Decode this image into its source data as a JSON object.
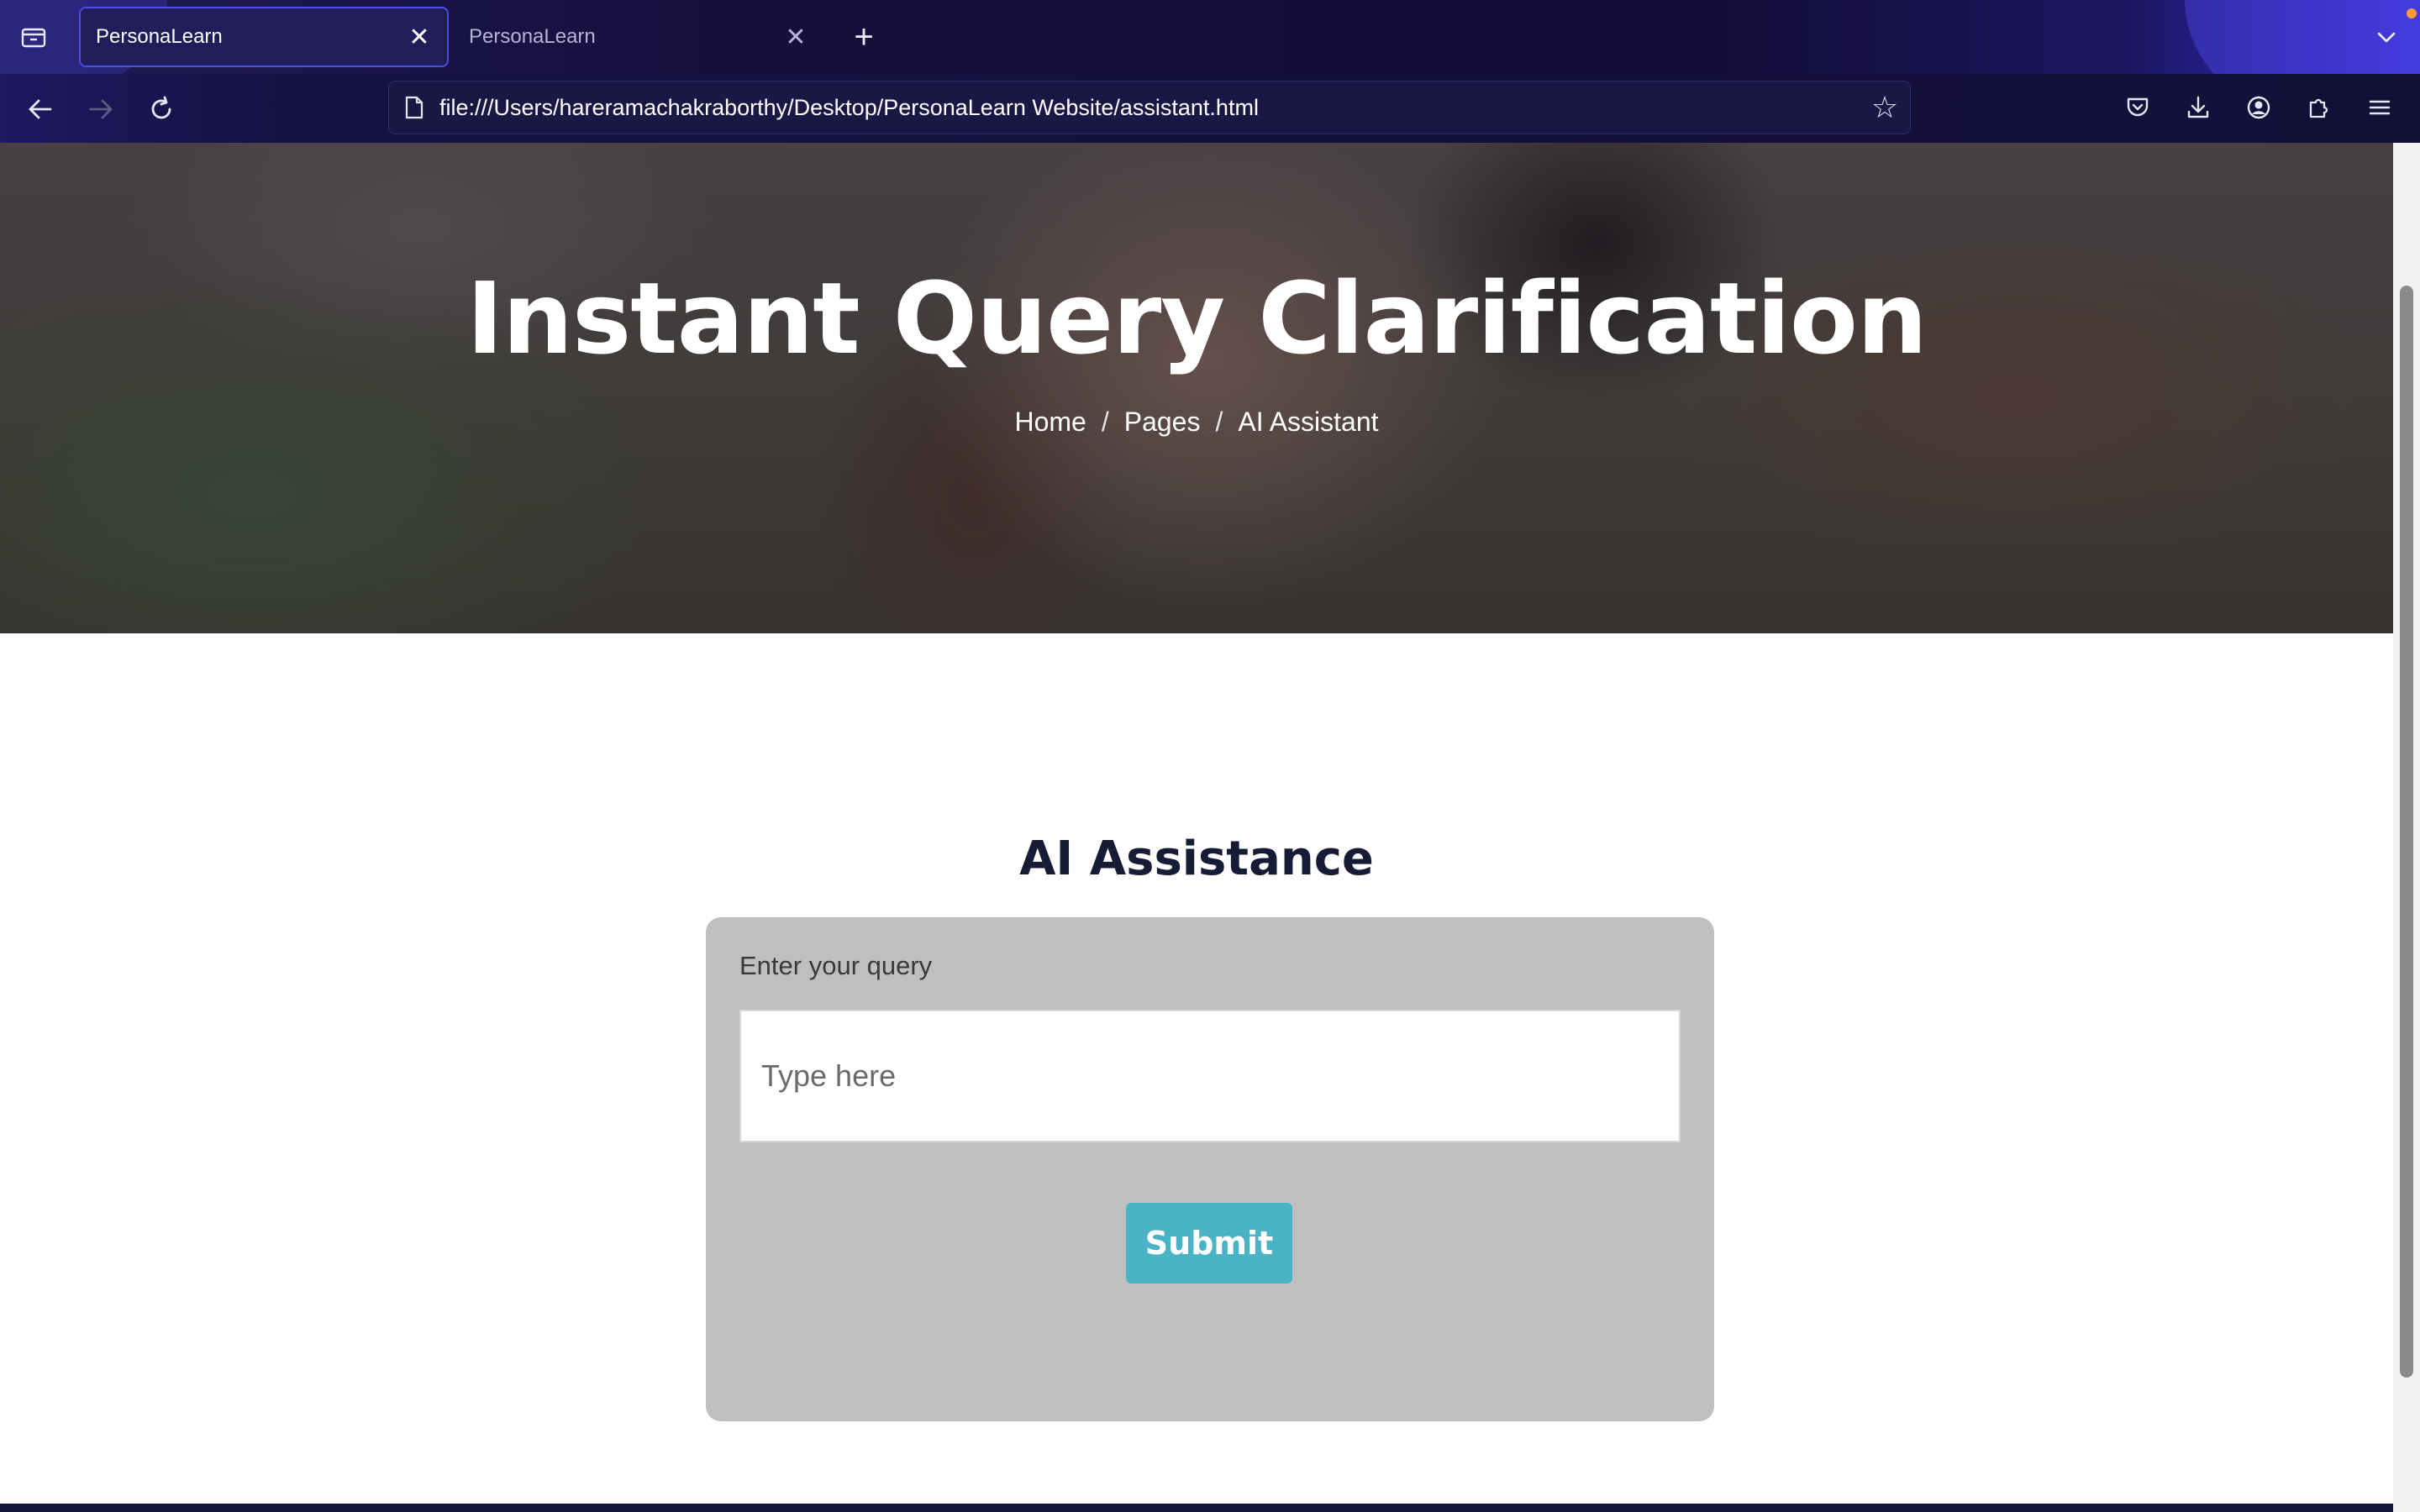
{
  "browser": {
    "tabs": [
      {
        "label": "PersonaLearn",
        "active": true
      },
      {
        "label": "PersonaLearn",
        "active": false
      }
    ],
    "url": "file:///Users/hareramachakraborthy/Desktop/PersonaLearn Website/assistant.html"
  },
  "hero": {
    "title": "Instant Query Clarification",
    "breadcrumb": [
      "Home",
      "Pages",
      "AI Assistant"
    ],
    "separator": "/"
  },
  "section": {
    "title": "AI Assistance"
  },
  "form": {
    "label": "Enter your query",
    "placeholder": "Type here",
    "value": "",
    "submit_label": "Submit"
  },
  "colors": {
    "accent": "#4ab3c5",
    "heading": "#161b36",
    "card_background": "#bfbfbf"
  },
  "icons": {
    "tab_list": "tab-list-icon",
    "tab_close": "close-icon",
    "new_tab": "plus-icon",
    "back": "arrow-left-icon",
    "forward": "arrow-right-icon",
    "reload": "reload-icon",
    "page": "page-icon",
    "bookmark": "star-icon",
    "pocket": "pocket-icon",
    "downloads": "download-icon",
    "account": "account-icon",
    "extensions": "puzzle-icon",
    "menu": "hamburger-menu-icon"
  }
}
